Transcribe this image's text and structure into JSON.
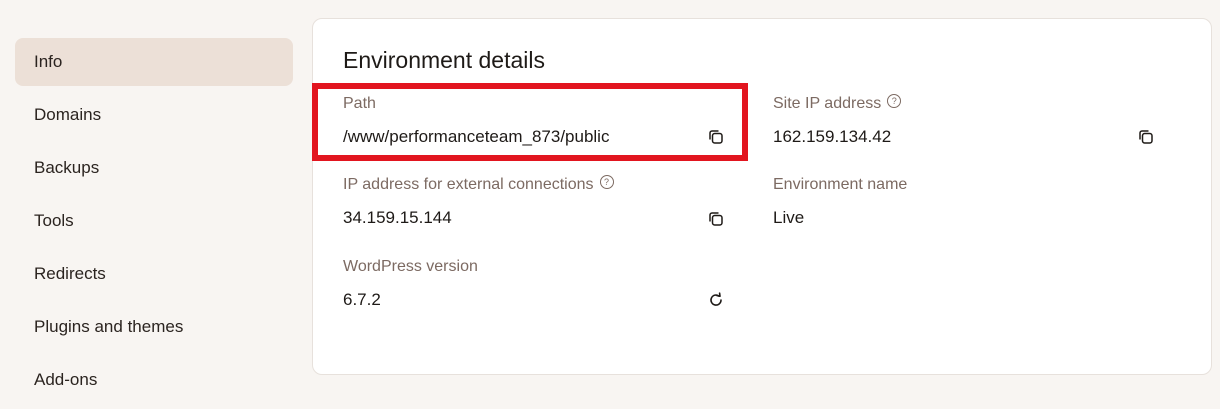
{
  "sidebar": {
    "items": [
      {
        "label": "Info",
        "active": true
      },
      {
        "label": "Domains"
      },
      {
        "label": "Backups"
      },
      {
        "label": "Tools"
      },
      {
        "label": "Redirects"
      },
      {
        "label": "Plugins and themes"
      },
      {
        "label": "Add-ons"
      }
    ]
  },
  "environment": {
    "title": "Environment details",
    "path": {
      "label": "Path",
      "value": "/www/performanceteam_873/public",
      "action_icon": "copy-icon"
    },
    "site_ip": {
      "label": "Site IP address",
      "help_icon": "question-circle-icon",
      "value": "162.159.134.42",
      "action_icon": "copy-icon"
    },
    "external_ip": {
      "label": "IP address for external connections",
      "help_icon": "question-circle-icon",
      "value": "34.159.15.144",
      "action_icon": "copy-icon"
    },
    "env_name": {
      "label": "Environment name",
      "value": "Live"
    },
    "wp_version": {
      "label": "WordPress version",
      "value": "6.7.2",
      "action_icon": "refresh-icon"
    }
  },
  "highlight_color": "#e2151f"
}
